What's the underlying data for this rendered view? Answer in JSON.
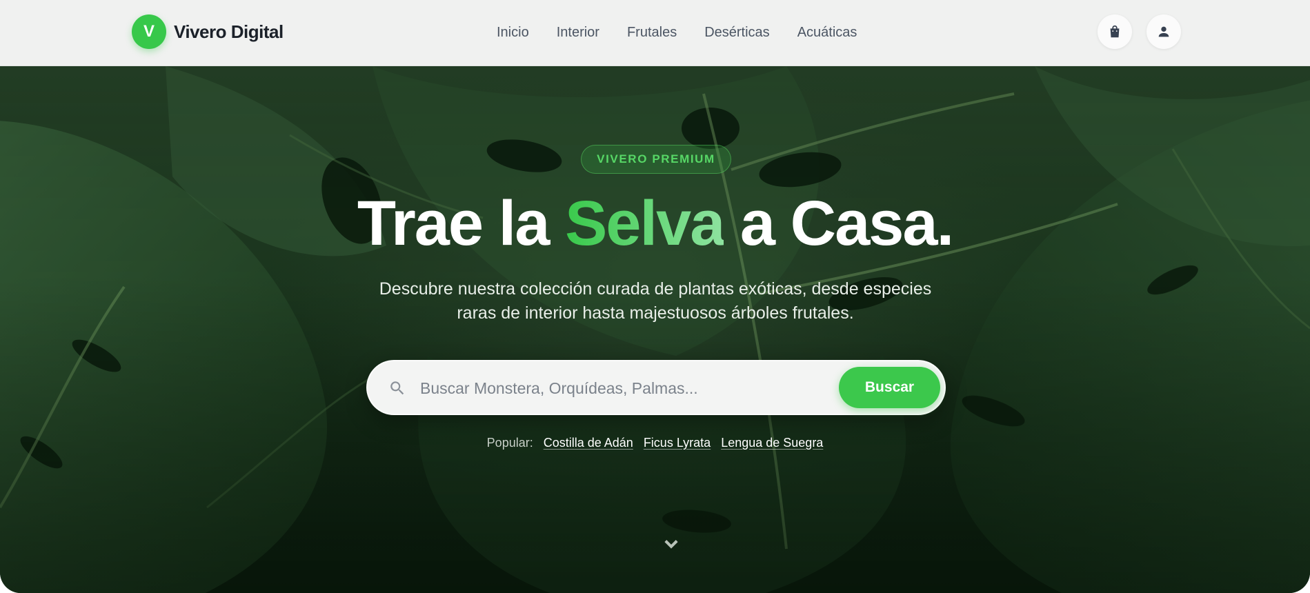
{
  "brand": {
    "mark": "V",
    "name": "Vivero Digital",
    "accent_color": "#37c84a"
  },
  "nav": {
    "items": [
      {
        "label": "Inicio"
      },
      {
        "label": "Interior"
      },
      {
        "label": "Frutales"
      },
      {
        "label": "Desérticas"
      },
      {
        "label": "Acuáticas"
      }
    ]
  },
  "header_actions": [
    {
      "icon": "shopping-bag-icon"
    },
    {
      "icon": "user-icon"
    }
  ],
  "hero": {
    "badge": "VIVERO PREMIUM",
    "headline": {
      "before": "Trae la ",
      "accent": "Selva",
      "after": " a Casa."
    },
    "subtitle": "Descubre nuestra colección curada de plantas exóticas, desde especies raras de interior hasta majestuosos árboles frutales.",
    "background": "monstera-leaves-photo"
  },
  "search": {
    "placeholder": "Buscar Monstera, Orquídeas, Palmas...",
    "value": "",
    "button_label": "Buscar",
    "button_color": "#3cc84c"
  },
  "popular": {
    "label": "Popular:",
    "tags": [
      "Costilla de Adán",
      "Ficus Lyrata",
      "Lengua de Suegra"
    ]
  },
  "scroll_cue": {
    "icon": "chevron-down-icon"
  }
}
